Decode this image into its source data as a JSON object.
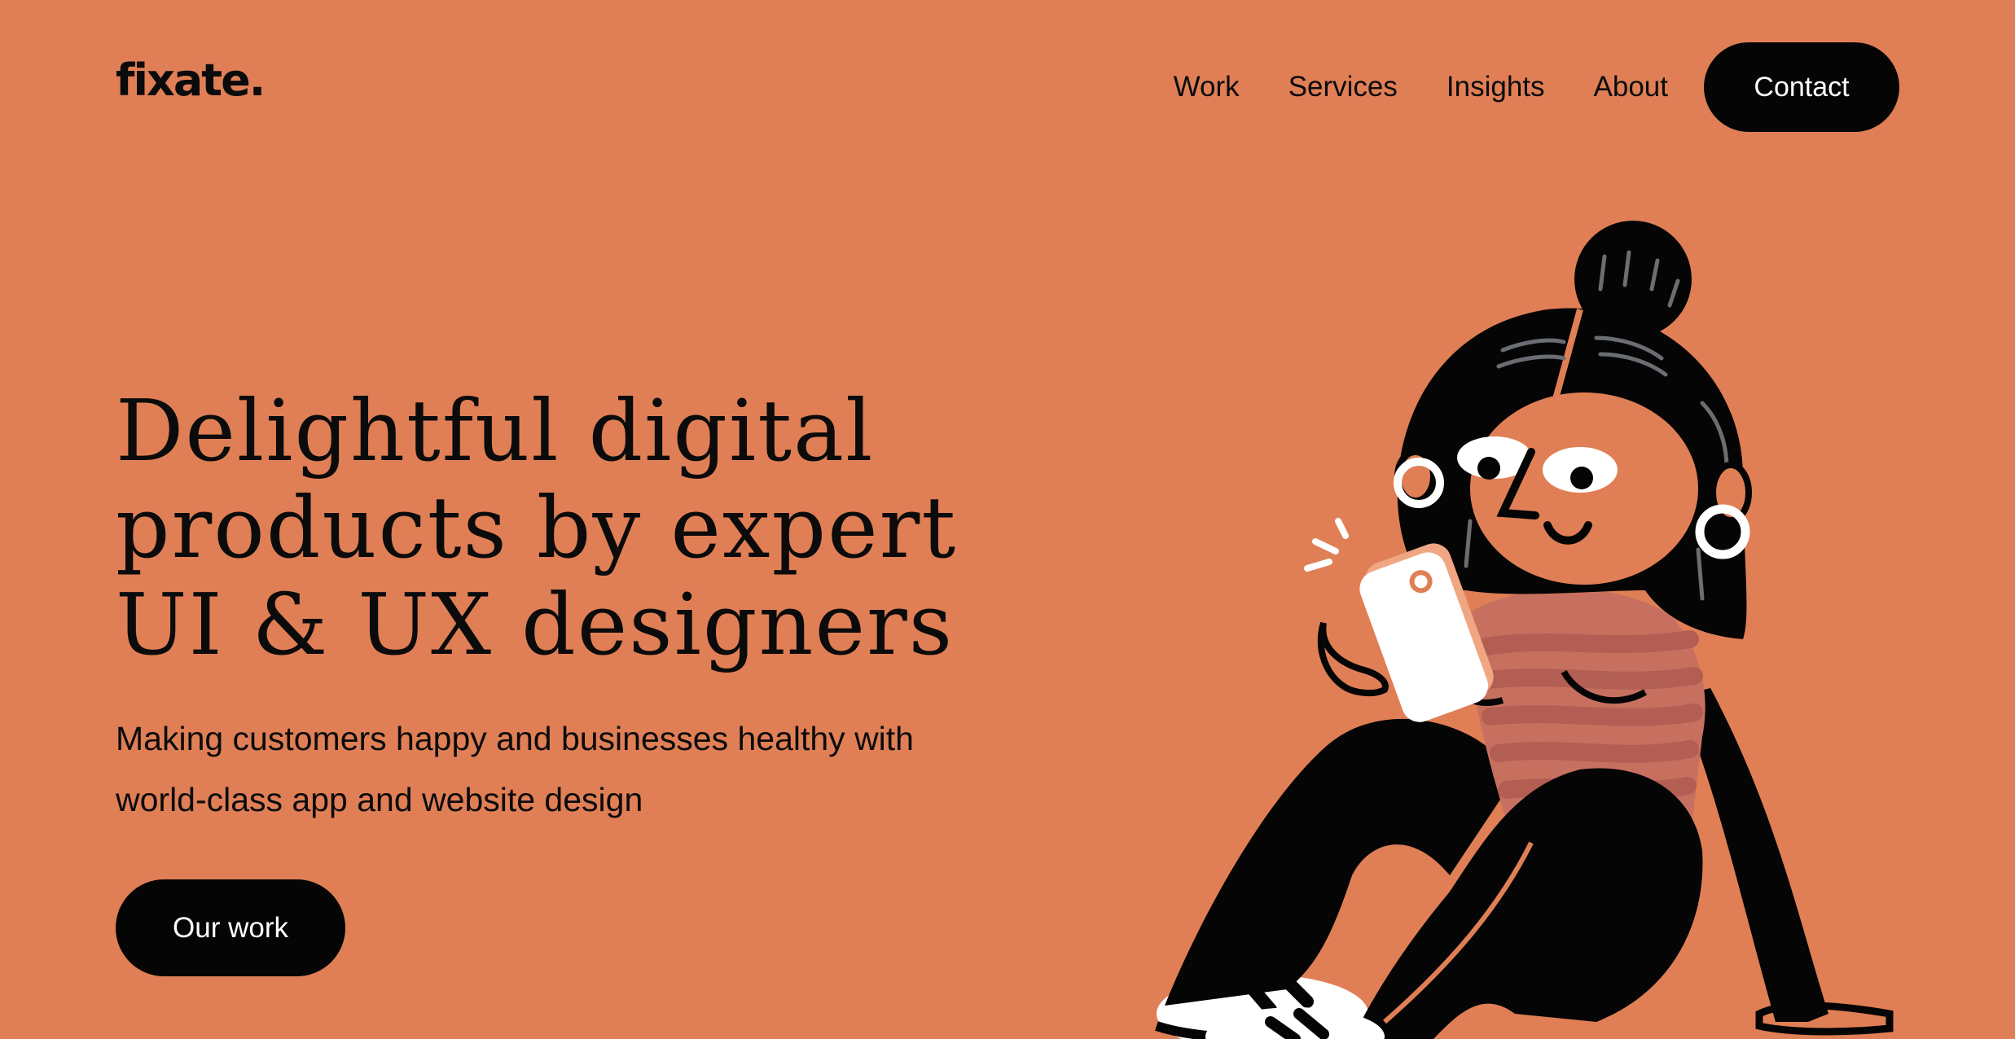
{
  "header": {
    "logo": "fixate.",
    "nav": [
      {
        "label": "Work"
      },
      {
        "label": "Services"
      },
      {
        "label": "Insights"
      },
      {
        "label": "About"
      }
    ],
    "contact_label": "Contact"
  },
  "hero": {
    "headline_lines": [
      "Delightful digital",
      "products by expert",
      "UI & UX designers"
    ],
    "subtitle": "Making customers happy and businesses healthy with world-class app and website design",
    "cta_label": "Our work"
  },
  "illustration": {
    "subject": "woman-sitting-with-phone",
    "colors": {
      "background": "#e07f55",
      "ink": "#050506",
      "shirt": "#c87060",
      "shirt_stripe": "#b25e52",
      "white": "#ffffff"
    }
  }
}
